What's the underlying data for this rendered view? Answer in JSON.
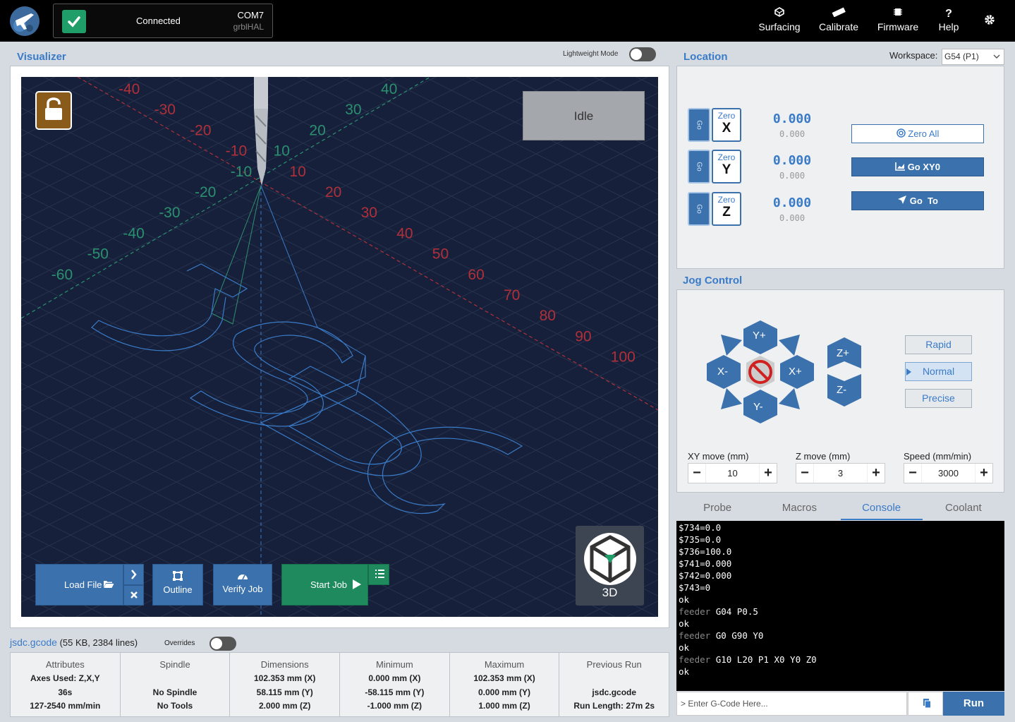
{
  "header": {
    "connection": {
      "status": "Connected",
      "port": "COM7",
      "firmware": "grblHAL"
    },
    "nav": [
      {
        "label": "Surfacing",
        "icon": "surfacing-icon"
      },
      {
        "label": "Calibrate",
        "icon": "ruler-icon"
      },
      {
        "label": "Firmware",
        "icon": "chip-icon"
      },
      {
        "label": "Help",
        "icon": "question-icon"
      }
    ]
  },
  "visualizer": {
    "title": "Visualizer",
    "lightweight_label": "Lightweight Mode",
    "lightweight_on": false,
    "state": "Idle",
    "axis_labels_red": [
      "-40",
      "-30",
      "-20",
      "-10",
      "10",
      "20",
      "30",
      "40",
      "50",
      "60",
      "70",
      "80",
      "90",
      "100"
    ],
    "axis_labels_green": [
      "40",
      "30",
      "20",
      "10",
      "-10",
      "-20",
      "-30",
      "-40",
      "-50",
      "-60"
    ],
    "buttons": {
      "load_file": "Load File",
      "outline": "Outline",
      "verify_job": "Verify Job",
      "start_job": "Start Job",
      "view_mode": "3D"
    }
  },
  "file": {
    "name": "jsdc.gcode",
    "meta": "(55 KB, 2384 lines)",
    "overrides_label": "Overrides",
    "overrides_on": false
  },
  "stats": [
    {
      "head": "Attributes",
      "values": [
        "Axes Used: Z,X,Y",
        "36s",
        "127-2540 mm/min"
      ]
    },
    {
      "head": "Spindle",
      "values": [
        "",
        "No Spindle",
        "No Tools"
      ]
    },
    {
      "head": "Dimensions",
      "values": [
        "102.353 mm (X)",
        "58.115 mm (Y)",
        "2.000 mm (Z)"
      ]
    },
    {
      "head": "Minimum",
      "values": [
        "0.000 mm (X)",
        "-58.115 mm (Y)",
        "-1.000 mm (Z)"
      ]
    },
    {
      "head": "Maximum",
      "values": [
        "102.353 mm (X)",
        "0.000 mm (Y)",
        "1.000 mm (Z)"
      ]
    },
    {
      "head": "Previous Run",
      "values": [
        "",
        "jsdc.gcode",
        "Run Length: 27m 2s"
      ]
    }
  ],
  "location": {
    "title": "Location",
    "workspace_label": "Workspace:",
    "workspace_value": "G54 (P1)",
    "go_label": "Go",
    "zero_label": "Zero",
    "axes": [
      {
        "axis": "X",
        "work": "0.000",
        "machine": "0.000"
      },
      {
        "axis": "Y",
        "work": "0.000",
        "machine": "0.000"
      },
      {
        "axis": "Z",
        "work": "0.000",
        "machine": "0.000"
      }
    ],
    "actions": {
      "zero_all": "Zero All",
      "go_xy0": "Go XY0",
      "go_to": "Go  To"
    }
  },
  "jog": {
    "title": "Jog Control",
    "buttons": {
      "y_plus": "Y+",
      "y_minus": "Y-",
      "x_plus": "X+",
      "x_minus": "X-",
      "z_plus": "Z+",
      "z_minus": "Z-"
    },
    "modes": [
      "Rapid",
      "Normal",
      "Precise"
    ],
    "active_mode": "Normal",
    "xy_label": "XY move (mm)",
    "xy_value": "10",
    "z_label": "Z move (mm)",
    "z_value": "3",
    "speed_label": "Speed (mm/min)",
    "speed_value": "3000"
  },
  "tabs": [
    "Probe",
    "Macros",
    "Console",
    "Coolant"
  ],
  "active_tab": "Console",
  "console": {
    "lines": [
      {
        "text": "$734=0.0"
      },
      {
        "text": "$735=0.0"
      },
      {
        "text": "$736=100.0"
      },
      {
        "text": "$741=0.000"
      },
      {
        "text": "$742=0.000"
      },
      {
        "text": "$743=0"
      },
      {
        "text": "ok"
      },
      {
        "prefix": "feeder",
        "text": "G04 P0.5"
      },
      {
        "text": "ok"
      },
      {
        "prefix": "feeder",
        "text": "G0 G90 Y0"
      },
      {
        "text": "ok"
      },
      {
        "prefix": "feeder",
        "text": "G10 L20 P1 X0 Y0 Z0"
      },
      {
        "text": "ok"
      }
    ],
    "input_placeholder": "> Enter G-Code Here...",
    "run_label": "Run"
  },
  "colors": {
    "accent": "#3a7bc8",
    "green": "#1e8a5d",
    "canvas": "#16203a",
    "brown": "#8a5a1a"
  }
}
